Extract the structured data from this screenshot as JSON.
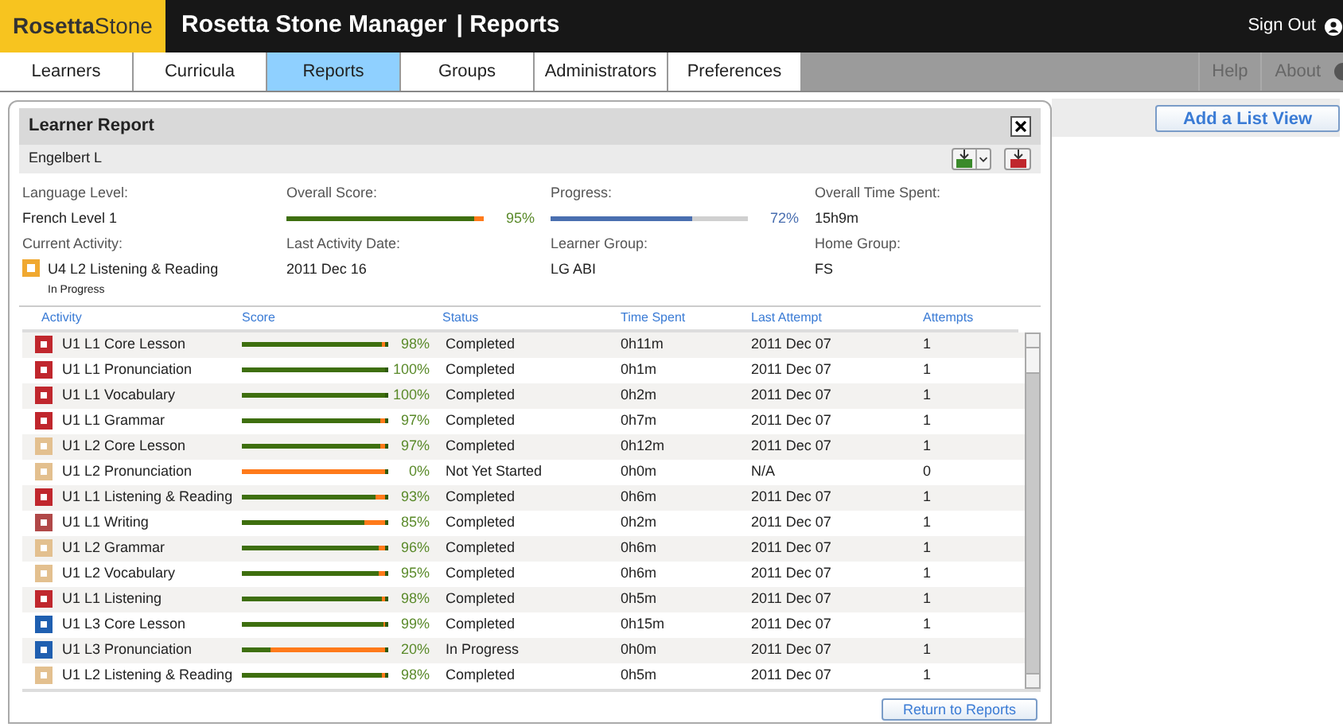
{
  "header": {
    "logo": "**Rosetta**Stone",
    "title": "Rosetta Stone Manager",
    "section": "| Reports",
    "sign_out": "Sign Out"
  },
  "nav": {
    "tabs": [
      {
        "label": "Learners",
        "selected": false
      },
      {
        "label": "Curricula",
        "selected": false
      },
      {
        "label": "Reports",
        "selected": true
      },
      {
        "label": "Groups",
        "selected": false
      },
      {
        "label": "Administrators",
        "selected": false
      },
      {
        "label": "Preferences",
        "selected": false
      }
    ],
    "links": [
      "Help",
      "About"
    ]
  },
  "add_list_view": "Add a List View",
  "dialog": {
    "title": "Learner Report",
    "learner": "Engelbert L",
    "summary": {
      "language_level_label": "Language Level:",
      "language_level": "French Level 1",
      "overall_score_label": "Overall Score:",
      "overall_score": {
        "level": 0.95,
        "reading": "95%"
      },
      "progress_label": "Progress:",
      "progress": {
        "level": 0.72,
        "reading": "72%"
      },
      "time_label": "Overall Time Spent:",
      "time": "15h9m",
      "current_activity_label": "Current Activity:",
      "current_activity": "U4 L2 Listening & Reading",
      "current_activity_status": "In Progress",
      "last_date_label": "Last Activity Date:",
      "last_date": "2011 Dec 16",
      "learner_group_label": "Learner Group:",
      "learner_group": "LG ABI",
      "home_group_label": "Home Group:",
      "home_group": "FS"
    },
    "table": {
      "columns": [
        "Activity",
        "Score",
        "Status",
        "Time Spent",
        "Last Attempt",
        "Attempts"
      ],
      "rows": [
        {
          "activity": "U1 L1 Core Lesson",
          "color": "#c0272d",
          "level": 0.98,
          "score": "98%",
          "status": "Completed",
          "time_spent": "0h11m",
          "last_attempt": "2011 Dec 07",
          "attempts": "1"
        },
        {
          "activity": "U1 L1 Pronunciation",
          "color": "#c0272d",
          "level": 1,
          "score": "100%",
          "status": "Completed",
          "time_spent": "0h1m",
          "last_attempt": "2011 Dec 07",
          "attempts": "1"
        },
        {
          "activity": "U1 L1 Vocabulary",
          "color": "#c0272d",
          "level": 1,
          "score": "100%",
          "status": "Completed",
          "time_spent": "0h2m",
          "last_attempt": "2011 Dec 07",
          "attempts": "1"
        },
        {
          "activity": "U1 L1 Grammar",
          "color": "#c0272d",
          "level": 0.97,
          "score": "97%",
          "status": "Completed",
          "time_spent": "0h7m",
          "last_attempt": "2011 Dec 07",
          "attempts": "1"
        },
        {
          "activity": "U1 L2 Core Lesson",
          "color": "#e3c08f",
          "level": 0.97,
          "score": "97%",
          "status": "Completed",
          "time_spent": "0h12m",
          "last_attempt": "2011 Dec 07",
          "attempts": "1"
        },
        {
          "activity": "U1 L2 Pronunciation",
          "color": "#e3c08f",
          "level": 0,
          "score": "0%",
          "status": "Not Yet Started",
          "time_spent": "0h0m",
          "last_attempt": "N/A",
          "attempts": "0"
        },
        {
          "activity": "U1 L1 Listening & Reading",
          "color": "#c0272d",
          "level": 0.93,
          "score": "93%",
          "status": "Completed",
          "time_spent": "0h6m",
          "last_attempt": "2011 Dec 07",
          "attempts": "1"
        },
        {
          "activity": "U1 L1 Writing",
          "color": "#b04848",
          "level": 0.85,
          "score": "85%",
          "status": "Completed",
          "time_spent": "0h2m",
          "last_attempt": "2011 Dec 07",
          "attempts": "1"
        },
        {
          "activity": "U1 L2 Grammar",
          "color": "#e3c08f",
          "level": 0.96,
          "score": "96%",
          "status": "Completed",
          "time_spent": "0h6m",
          "last_attempt": "2011 Dec 07",
          "attempts": "1"
        },
        {
          "activity": "U1 L2 Vocabulary",
          "color": "#e3c08f",
          "level": 0.95,
          "score": "95%",
          "status": "Completed",
          "time_spent": "0h6m",
          "last_attempt": "2011 Dec 07",
          "attempts": "1"
        },
        {
          "activity": "U1 L1 Listening",
          "color": "#c0272d",
          "level": 0.98,
          "score": "98%",
          "status": "Completed",
          "time_spent": "0h5m",
          "last_attempt": "2011 Dec 07",
          "attempts": "1"
        },
        {
          "activity": "U1 L3 Core Lesson",
          "color": "#1f5fb0",
          "level": 0.99,
          "score": "99%",
          "status": "Completed",
          "time_spent": "0h15m",
          "last_attempt": "2011 Dec 07",
          "attempts": "1"
        },
        {
          "activity": "U1 L3 Pronunciation",
          "color": "#1f5fb0",
          "level": 0.2,
          "score": "20%",
          "status": "In Progress",
          "time_spent": "0h0m",
          "last_attempt": "2011 Dec 07",
          "attempts": "1"
        },
        {
          "activity": "U1 L2 Listening & Reading",
          "color": "#e3c08f",
          "level": 0.98,
          "score": "98%",
          "status": "Completed",
          "time_spent": "0h5m",
          "last_attempt": "2011 Dec 07",
          "attempts": "1"
        }
      ]
    },
    "return_button": "Return to Reports"
  }
}
